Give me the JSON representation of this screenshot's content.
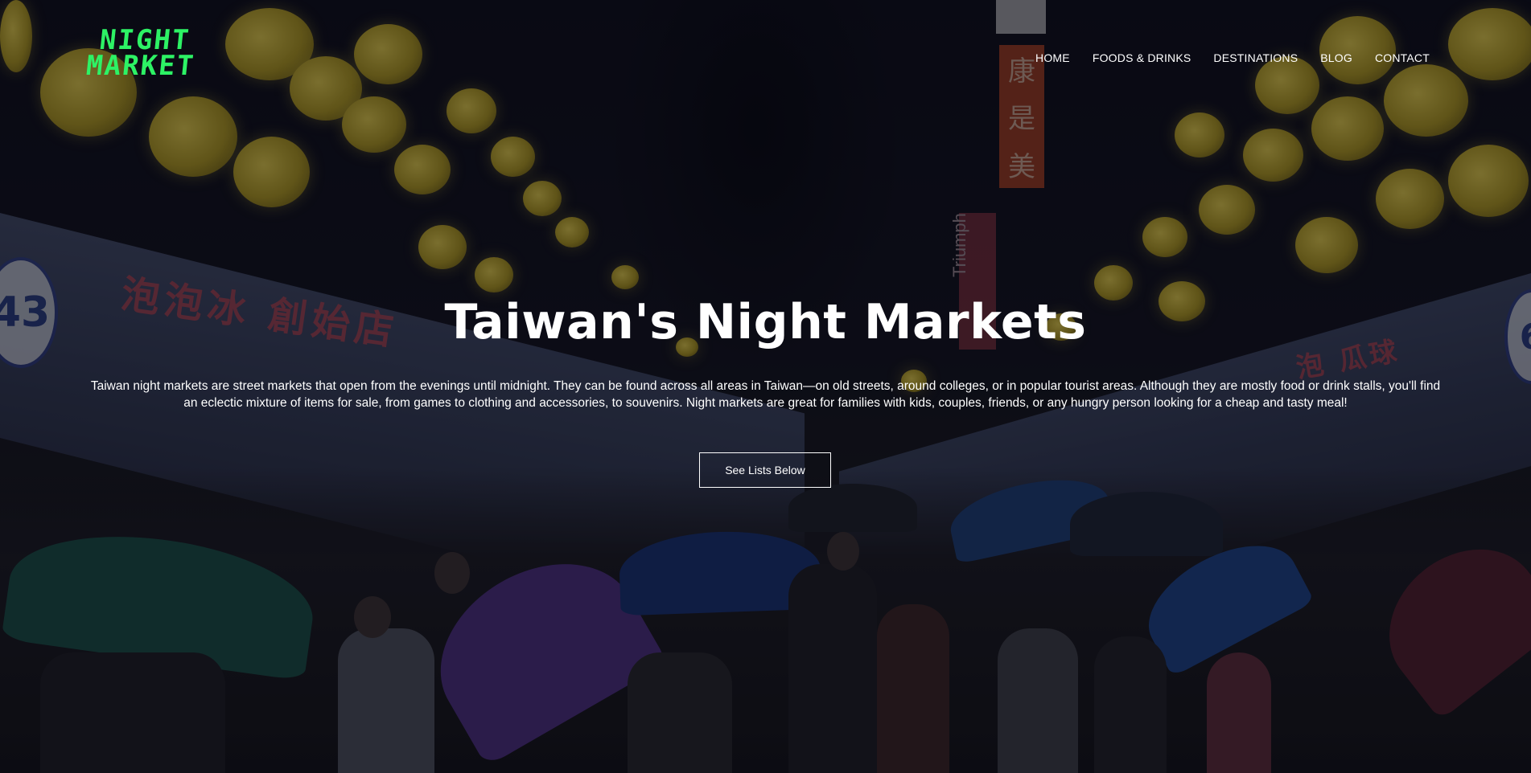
{
  "brand": {
    "logo_line1": "NIGHT",
    "logo_line2": "MARKET",
    "logo_color": "#2df265"
  },
  "nav": {
    "items": [
      {
        "label": "HOME"
      },
      {
        "label": "FOODS & DRINKS"
      },
      {
        "label": "DESTINATIONS"
      },
      {
        "label": "BLOG"
      },
      {
        "label": "CONTACT"
      }
    ]
  },
  "hero": {
    "title": "Taiwan's Night Markets",
    "description_line1": "Taiwan night markets are street markets that open from the evenings until midnight. They can be found across all areas in Taiwan—on old streets, around colleges, or in popular tourist areas. Although they are mostly food or drink stalls, you'll find",
    "description_line2": "an eclectic mixture of items for sale, from games to clothing and accessories, to souvenirs. Night markets are great for families with kids, couples, friends, or any hungry person looking for a cheap and tasty meal!",
    "cta_label": "See Lists Below"
  },
  "background": {
    "sign_left_text": "泡泡冰 創始店",
    "sign_right_text": "泡 瓜球",
    "stall_number_left": "43",
    "stall_number_right": "6",
    "vertical_sign_chars": [
      "康",
      "是",
      "美"
    ],
    "brand_sign_text": "Triumph"
  }
}
